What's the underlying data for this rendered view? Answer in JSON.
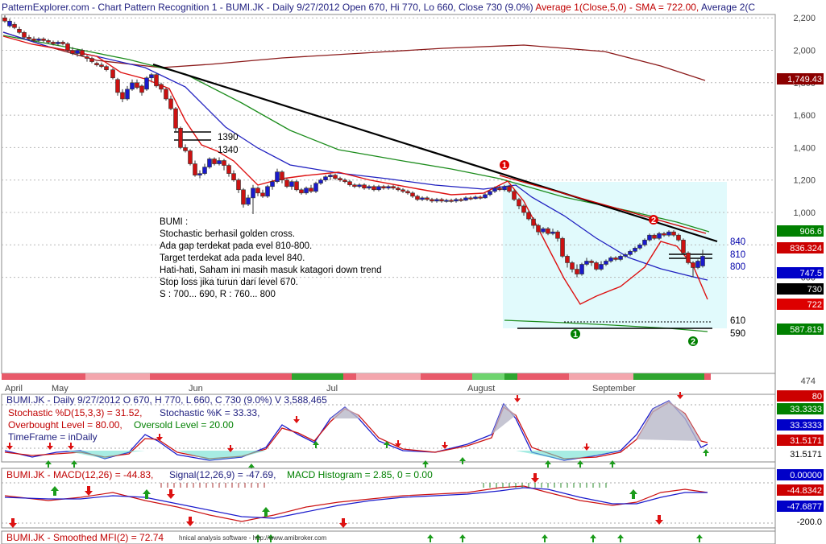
{
  "title_bar": {
    "segments": [
      {
        "text": "PatternExplorer.com - Chart Pattern Recognition 1",
        "color": "#202080"
      },
      {
        "text": "- BUMI.JK - Daily 9/27/2012 Open 670, Hi 770, Lo 660, Close 730 (9.0%)",
        "color": "#202080"
      },
      {
        "text": "Average 1(Close,5,0) - SMA = 722.00,",
        "color": "#c00000"
      },
      {
        "text": "Average 2(C",
        "color": "#202080"
      }
    ]
  },
  "price_axis": {
    "ticks": [
      "2,200",
      "2,000",
      "1,800",
      "1,600",
      "1,400",
      "1,200",
      "1,000",
      "800",
      "600",
      "474"
    ]
  },
  "price_badges": [
    {
      "text": "1,749.43",
      "bg": "#8b0000",
      "fg": "#ffffff"
    },
    {
      "text": "906.6",
      "bg": "#008000",
      "fg": "#ffffff"
    },
    {
      "text": "836.324",
      "bg": "#cc0000",
      "fg": "#ffffff"
    },
    {
      "text": "747.5",
      "bg": "#0000c8",
      "fg": "#ffffff"
    },
    {
      "text": "730",
      "bg": "#000000",
      "fg": "#ffffff"
    },
    {
      "text": "722",
      "bg": "#dd0000",
      "fg": "#ffffff"
    },
    {
      "text": "587.819",
      "bg": "#008000",
      "fg": "#ffffff"
    }
  ],
  "level_labels": {
    "l1390": "1390",
    "l1340": "1340",
    "r840": "840",
    "r810": "810",
    "r800": "800",
    "s610": "610",
    "s590": "590"
  },
  "markers": {
    "m1": "1",
    "m2": "2",
    "m1b": "1",
    "m2b": "2"
  },
  "annotation": {
    "lines": [
      "BUMI :",
      "Stochastic berhasil golden cross.",
      "Ada gap terdekat pada evel 810-800.",
      "Target terdekat ada pada level 840.",
      "Hati-hati, Saham ini masih masuk katagori down trend",
      "Stop loss jika turun dari level 670.",
      "S : 700... 690, R : 760... 800"
    ]
  },
  "months": [
    "April",
    "May",
    "Jun",
    "Jul",
    "August",
    "September"
  ],
  "stoch_panel": {
    "header": "BUMI.JK - Daily 9/27/2012 O 670, H 770, L 660, C 730 (9.0%) V 3,588,465",
    "line2a": "Stochastic %D(15,3,3) = 31.52,",
    "line2b": "Stochastic %K = 33.33,",
    "line3a": "Overbought Level = 80.00,",
    "line3b": "Oversold Level = 20.00",
    "line4": "TimeFrame = inDaily",
    "badges": [
      {
        "text": "80",
        "bg": "#cc0000",
        "fg": "#ffffff"
      },
      {
        "text": "33.3333",
        "bg": "#008000",
        "fg": "#ffffff"
      },
      {
        "text": "33.3333",
        "bg": "#0000c8",
        "fg": "#ffffff"
      },
      {
        "text": "31.5171",
        "bg": "#cc0000",
        "fg": "#ffffff"
      },
      {
        "text": "31.5171",
        "bg": "#ffffff",
        "fg": "#000000"
      }
    ]
  },
  "macd_panel": {
    "a": "BUMI.JK - MACD(12,26) = -44.83,",
    "b": "Signal(12,26,9) = -47.69,",
    "c": "MACD Histogram = 2.85, 0 = 0.00",
    "badges": [
      {
        "text": "0.00000",
        "bg": "#0000c8",
        "fg": "#ffffff"
      },
      {
        "text": "-44.8342",
        "bg": "#cc0000",
        "fg": "#ffffff"
      },
      {
        "text": "-47.6877",
        "bg": "#0000c8",
        "fg": "#ffffff"
      },
      {
        "text": "-200.0",
        "bg": "#ffffff",
        "fg": "#000000"
      }
    ]
  },
  "mfi_panel": {
    "label": "BUMI.JK - Smoothed MFI(2) = 72.74",
    "watermark": "hnical analysis software - http://www.amibroker.com"
  },
  "chart_data": {
    "type": "candlestick",
    "symbol": "BUMI.JK",
    "last_bar": {
      "date": "9/27/2012",
      "open": 670,
      "high": 770,
      "low": 660,
      "close": 730,
      "change_pct": 9.0,
      "volume": 3588465
    },
    "ylim": [
      474,
      2250
    ],
    "indicators": {
      "sma5": 722.0,
      "avg_blue": 747.5,
      "avg_green_short": 906.6,
      "avg_green_long": 587.819,
      "avg_darkred": 1749.43,
      "red_channel": 836.324,
      "stoch_d": 31.52,
      "stoch_k": 33.33,
      "overbought": 80,
      "oversold": 20,
      "macd": -44.83,
      "signal": -47.69,
      "histogram": 2.85,
      "smoothed_mfi": 72.74
    },
    "levels": [
      1390,
      1340,
      840,
      810,
      800,
      610,
      590
    ]
  }
}
